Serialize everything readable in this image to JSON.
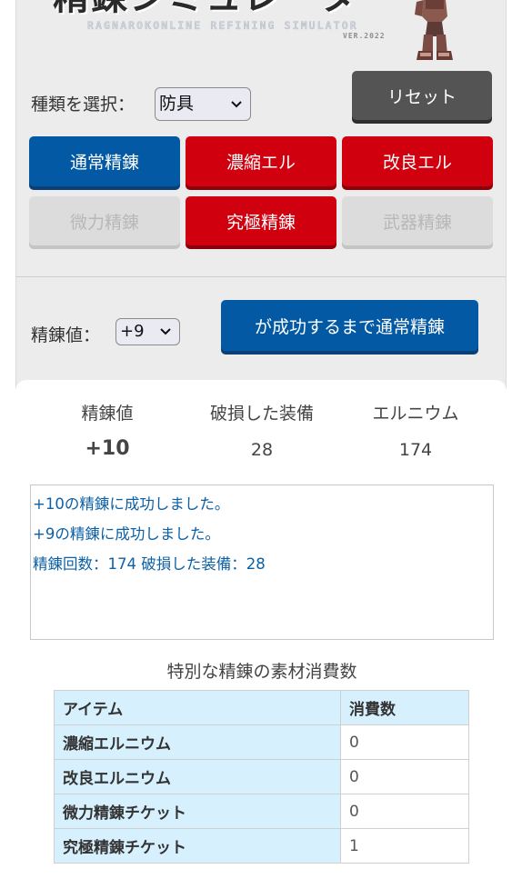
{
  "header": {
    "logo_text": "精錬シミュレータ",
    "logo_subtitle": "RAGNAROKONLINE REFINING SIMULATOR",
    "logo_version": "VER.2022"
  },
  "controls": {
    "type_label": "種類を選択：",
    "type_selected": "防具",
    "reset_label": "リセット",
    "refine_value_label": "精錬値：",
    "refine_value_selected": "+9",
    "run_until_success_label": "が成功するまで通常精錬"
  },
  "refine_buttons": [
    {
      "label": "通常精錬",
      "style": "blue"
    },
    {
      "label": "濃縮エル",
      "style": "red"
    },
    {
      "label": "改良エル",
      "style": "red"
    },
    {
      "label": "微力精錬",
      "style": "disabled"
    },
    {
      "label": "究極精錬",
      "style": "red"
    },
    {
      "label": "武器精錬",
      "style": "disabled"
    }
  ],
  "stats": {
    "refine_header": "精錬値",
    "refine_value": "+10",
    "broken_header": "破損した装備",
    "broken_value": "28",
    "elunium_header": "エルニウム",
    "elunium_value": "174"
  },
  "log": [
    "+10の精錬に成功しました。",
    "+9の精錬に成功しました。",
    "精錬回数：174 破損した装備：28"
  ],
  "materials": {
    "title": "特別な精錬の素材消費数",
    "header_item": "アイテム",
    "header_count": "消費数",
    "rows": [
      {
        "item": "濃縮エルニウム",
        "count": "0"
      },
      {
        "item": "改良エルニウム",
        "count": "0"
      },
      {
        "item": "微力精錬チケット",
        "count": "0"
      },
      {
        "item": "究極精錬チケット",
        "count": "1"
      }
    ]
  },
  "colors": {
    "blue_button": "#0459a4",
    "red_button": "#d0000e",
    "reset_button": "#545454",
    "disabled_button": "#dcdcdc",
    "log_text": "#0c60a5",
    "table_header_bg": "#d7f0fd"
  }
}
